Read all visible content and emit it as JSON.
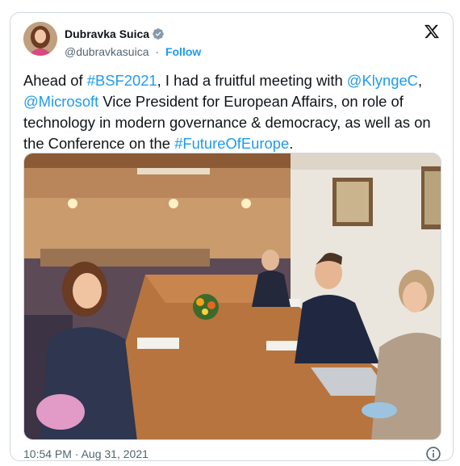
{
  "author": {
    "name": "Dubravka Suica",
    "handle": "@dubravkasuica",
    "separator": "·",
    "follow_label": "Follow"
  },
  "icons": {
    "verified": "verified-badge-icon",
    "logo": "x-logo-icon",
    "info": "info-icon"
  },
  "tweet": {
    "segments": [
      {
        "text": "Ahead of ",
        "link": false
      },
      {
        "text": "#BSF2021",
        "link": true
      },
      {
        "text": ", I had a fruitful meeting with ",
        "link": false
      },
      {
        "text": "@KlyngeC",
        "link": true
      },
      {
        "text": ", ",
        "link": false
      },
      {
        "text": "@Microsoft",
        "link": true
      },
      {
        "text": " Vice President for European Affairs, on role of technology in modern governance & democracy, as well as on the Conference on the ",
        "link": false
      },
      {
        "text": "#FutureOfEurope",
        "link": true
      },
      {
        "text": ".",
        "link": false
      }
    ]
  },
  "timestamp": "10:54 PM · Aug 31, 2021",
  "colors": {
    "link": "#1d9bf0",
    "text": "#0f1419",
    "muted": "#536471",
    "border": "#cfd9de"
  }
}
